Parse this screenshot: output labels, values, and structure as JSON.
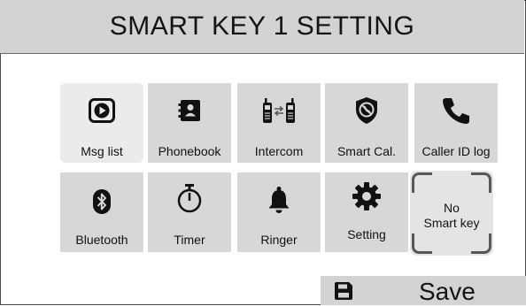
{
  "header": {
    "title": "SMART KEY 1 SETTING"
  },
  "tiles": [
    {
      "label": "Msg list",
      "icon": "play-message-icon",
      "selected": true
    },
    {
      "label": "Phonebook",
      "icon": "phonebook-icon"
    },
    {
      "label": "Intercom",
      "icon": "intercom-icon"
    },
    {
      "label": "Smart Cal.",
      "icon": "shield-blocked-phone-icon"
    },
    {
      "label": "Caller ID log",
      "icon": "phone-handset-icon"
    },
    {
      "label": "Bluetooth",
      "icon": "bluetooth-icon"
    },
    {
      "label": "Timer",
      "icon": "stopwatch-icon"
    },
    {
      "label": "Ringer",
      "icon": "bell-icon"
    },
    {
      "label": "Setting",
      "icon": "gear-icon"
    }
  ],
  "no_smart_key": {
    "line1": "No",
    "line2": "Smart key"
  },
  "footer": {
    "save_label": "Save",
    "save_icon": "floppy-disk-icon"
  },
  "colors": {
    "tile": "#d7d7d7",
    "selected_tile": "#ebebeb",
    "bar": "#d3d3d3",
    "icon": "#111111"
  }
}
